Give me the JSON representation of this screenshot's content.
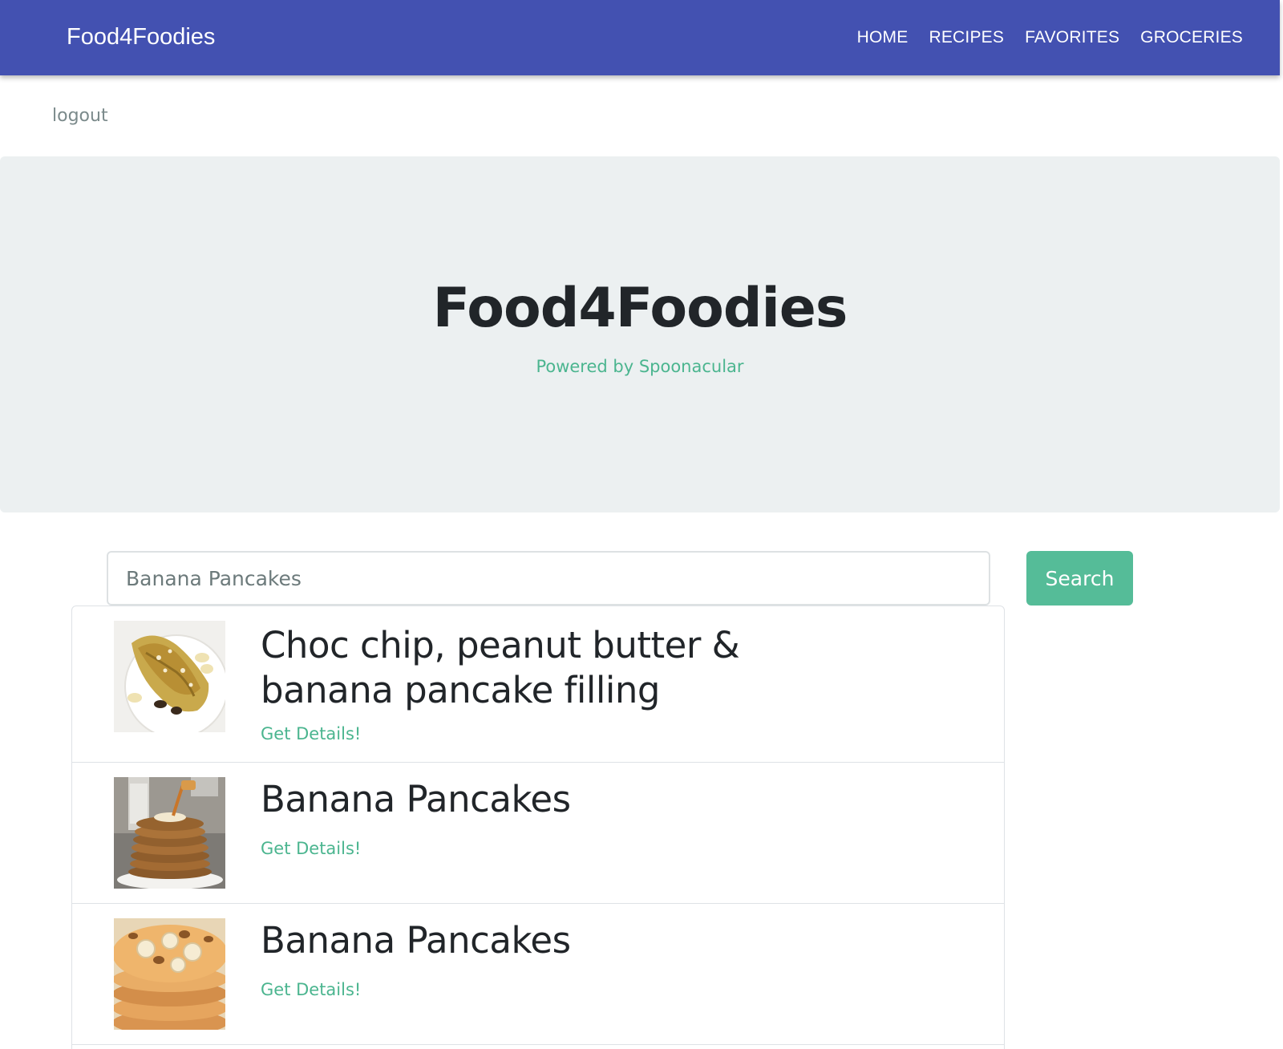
{
  "navbar": {
    "brand": "Food4Foodies",
    "links": [
      "HOME",
      "RECIPES",
      "FAVORITES",
      "GROCERIES"
    ],
    "color": "#4351b1"
  },
  "logout_label": "logout",
  "jumbotron": {
    "title": "Food4Foodies",
    "subtitle": "Powered by Spoonacular"
  },
  "search": {
    "value": "Banana Pancakes",
    "button_label": "Search",
    "button_color": "#55bc98"
  },
  "results": [
    {
      "title": "Choc chip, peanut butter & banana pancake filling",
      "link_label": "Get Details!",
      "image": "crepe-photo"
    },
    {
      "title": "Banana Pancakes",
      "link_label": "Get Details!",
      "image": "pancake-stack-syrup-photo"
    },
    {
      "title": "Banana Pancakes",
      "link_label": "Get Details!",
      "image": "banana-pancake-stack-photo"
    }
  ]
}
